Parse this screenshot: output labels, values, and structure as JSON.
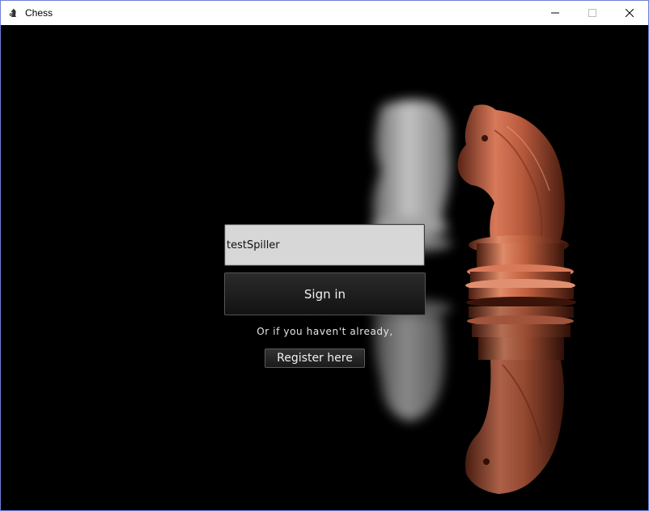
{
  "window": {
    "title": "Chess",
    "controls": [
      "minimize-icon",
      "maximize-icon",
      "close-icon"
    ]
  },
  "login": {
    "username_value": "testSpiller",
    "signin_label": "Sign in",
    "or_text": "Or if you haven't already,",
    "register_label": "Register here"
  },
  "background": {
    "image": "chess knights (white and copper) with reflection",
    "colors": {
      "background": "#000000",
      "copper": "#b5583a",
      "silver": "#d6d6d6"
    }
  }
}
